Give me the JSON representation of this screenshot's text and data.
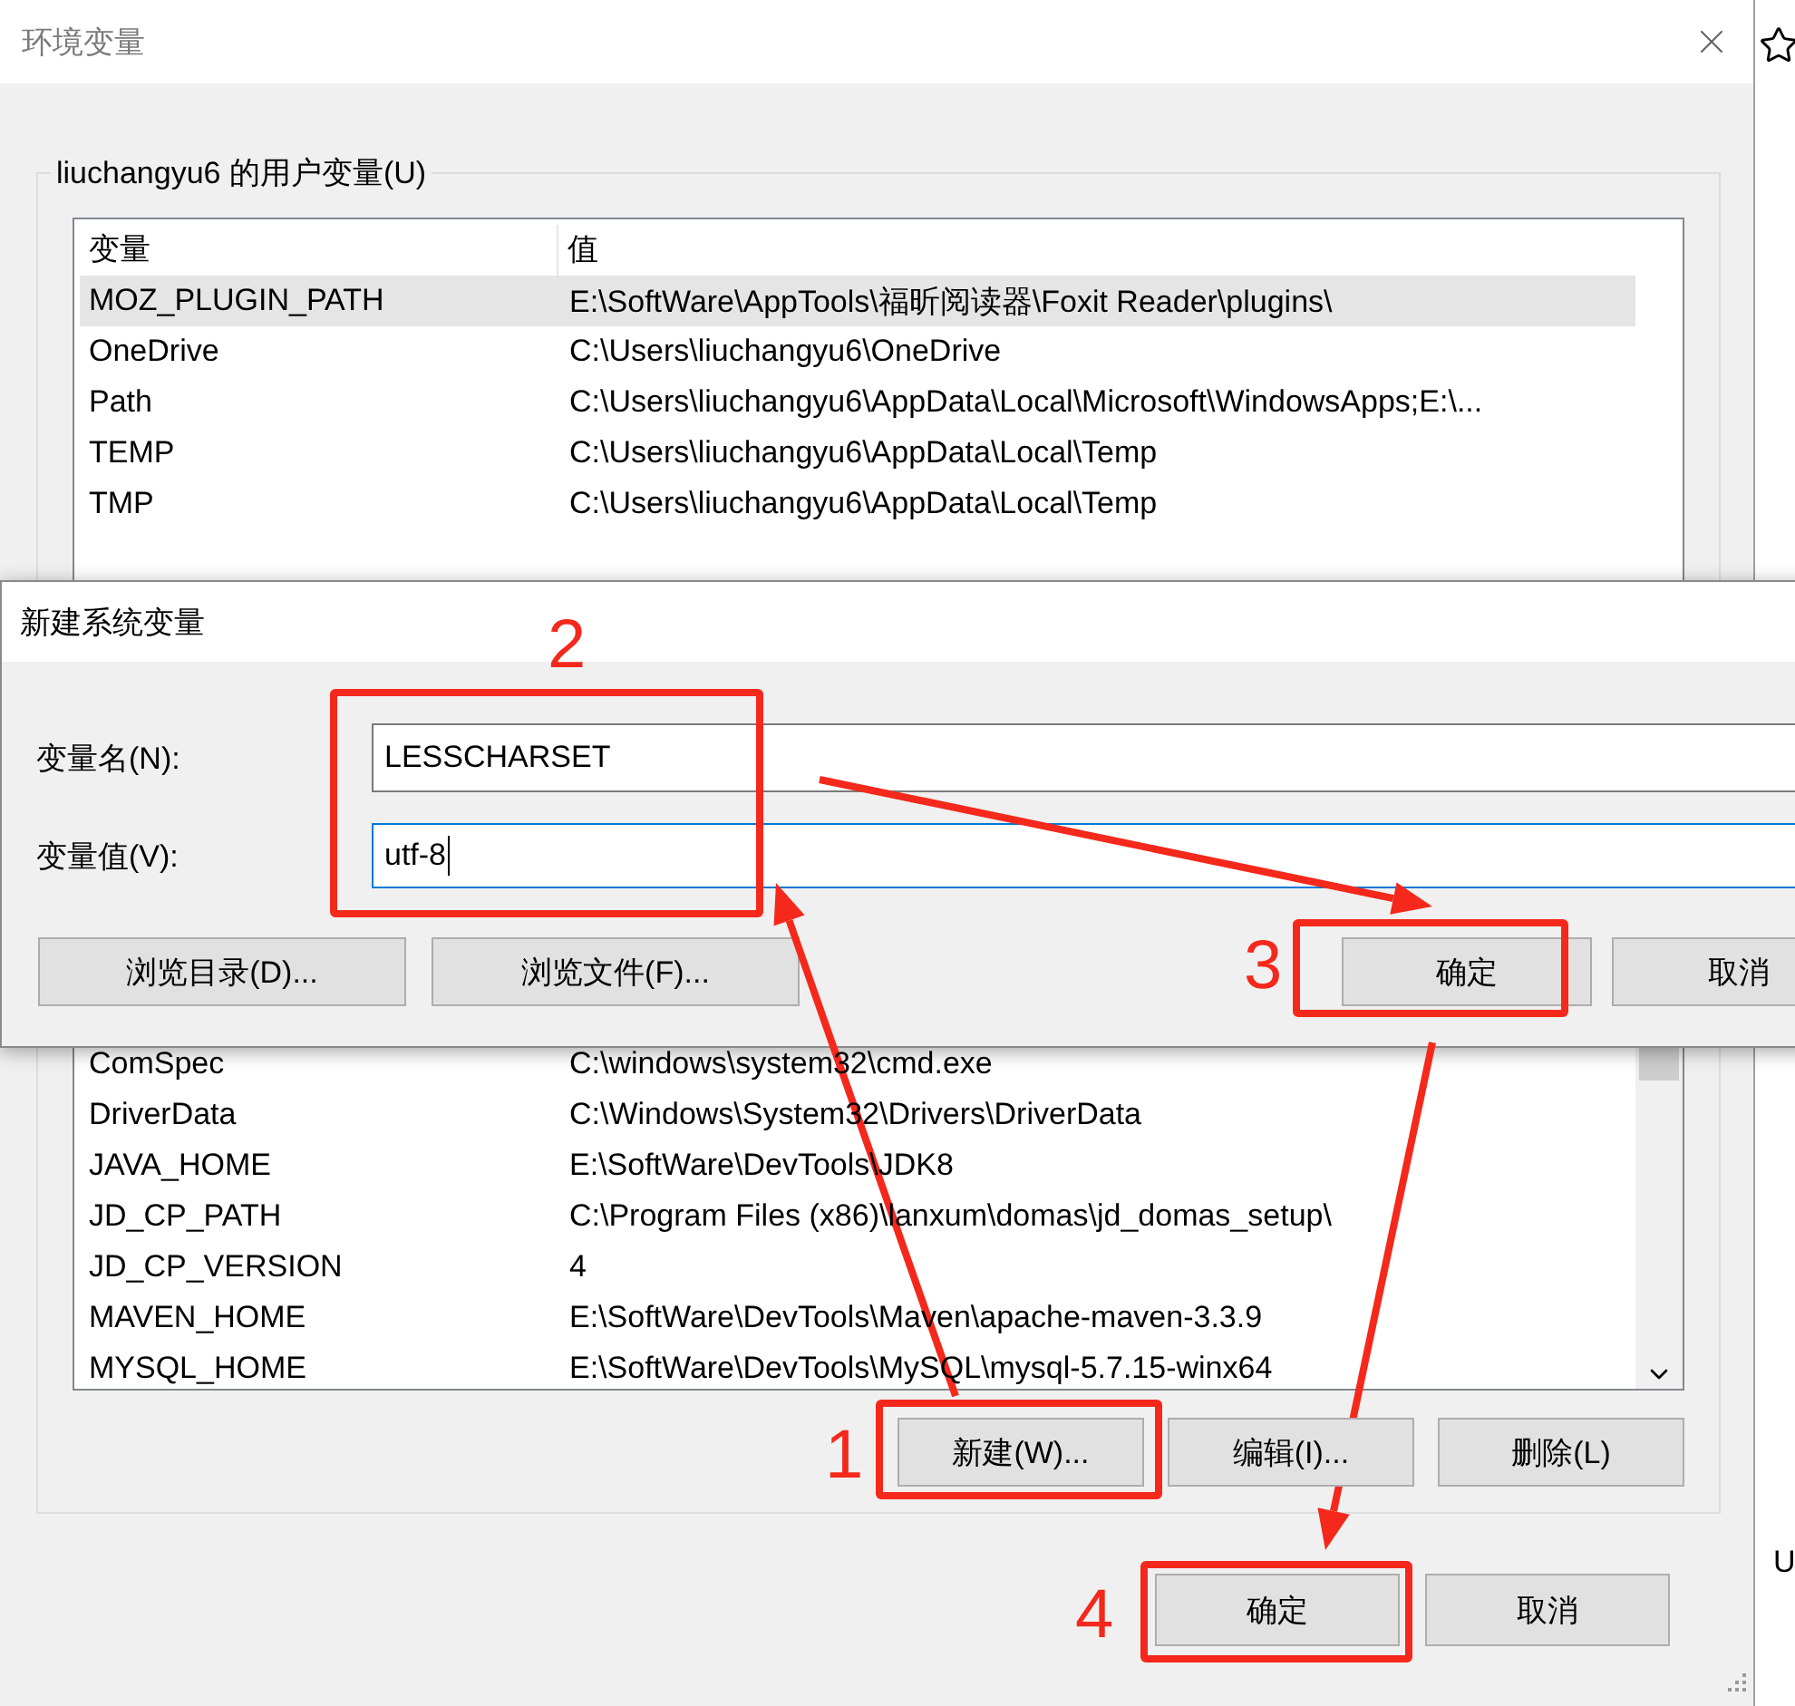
{
  "window": {
    "title": "环境变量"
  },
  "user_variables": {
    "title": "liuchangyu6 的用户变量(U)",
    "columns": [
      "变量",
      "值"
    ],
    "rows": [
      {
        "name": "MOZ_PLUGIN_PATH",
        "value": "E:\\SoftWare\\AppTools\\福昕阅读器\\Foxit Reader\\plugins\\",
        "selected": true
      },
      {
        "name": "OneDrive",
        "value": "C:\\Users\\liuchangyu6\\OneDrive",
        "selected": false
      },
      {
        "name": "Path",
        "value": "C:\\Users\\liuchangyu6\\AppData\\Local\\Microsoft\\WindowsApps;E:\\...",
        "selected": false
      },
      {
        "name": "TEMP",
        "value": "C:\\Users\\liuchangyu6\\AppData\\Local\\Temp",
        "selected": false
      },
      {
        "name": "TMP",
        "value": "C:\\Users\\liuchangyu6\\AppData\\Local\\Temp",
        "selected": false
      }
    ]
  },
  "system_variables": {
    "rows": [
      {
        "name": "ComSpec",
        "value": "C:\\windows\\system32\\cmd.exe",
        "selected": false
      },
      {
        "name": "DriverData",
        "value": "C:\\Windows\\System32\\Drivers\\DriverData",
        "selected": false
      },
      {
        "name": "JAVA_HOME",
        "value": "E:\\SoftWare\\DevTools\\JDK8",
        "selected": false
      },
      {
        "name": "JD_CP_PATH",
        "value": "C:\\Program Files (x86)\\lanxum\\domas\\jd_domas_setup\\",
        "selected": false
      },
      {
        "name": "JD_CP_VERSION",
        "value": "4",
        "selected": false
      },
      {
        "name": "MAVEN_HOME",
        "value": "E:\\SoftWare\\DevTools\\Maven\\apache-maven-3.3.9",
        "selected": false
      },
      {
        "name": "MYSQL_HOME",
        "value": "E:\\SoftWare\\DevTools\\MySQL\\mysql-5.7.15-winx64",
        "selected": false
      }
    ],
    "buttons": [
      "新建(W)...",
      "编辑(I)...",
      "删除(L)"
    ]
  },
  "footer_buttons": [
    "确定",
    "取消"
  ],
  "dialog": {
    "title": "新建系统变量",
    "fields": [
      {
        "label": "变量名(N):",
        "value": "LESSCHARSET",
        "focused": false
      },
      {
        "label": "变量值(V):",
        "value": "utf-8",
        "focused": true
      }
    ],
    "buttons": [
      "浏览目录(D)...",
      "浏览文件(F)...",
      "确定",
      "取消"
    ]
  },
  "background_text": "U",
  "annotations": [
    {
      "label": "1"
    },
    {
      "label": "2"
    },
    {
      "label": "3"
    },
    {
      "label": "4"
    }
  ]
}
